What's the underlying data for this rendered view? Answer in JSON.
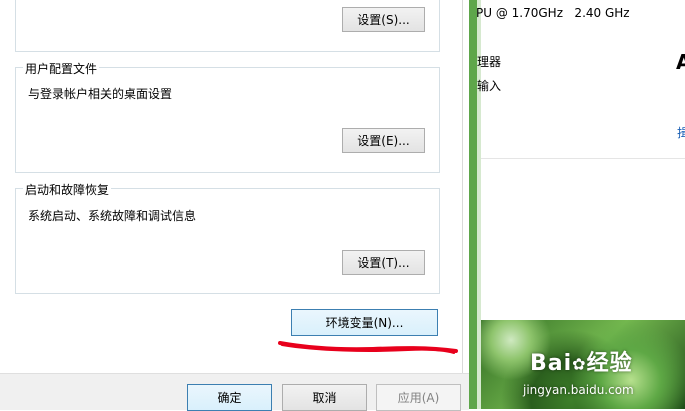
{
  "dialog": {
    "performance_group": {
      "button_label": "设置(S)..."
    },
    "user_profiles_group": {
      "title": "用户配置文件",
      "description": "与登录帐户相关的桌面设置",
      "button_label": "设置(E)..."
    },
    "startup_recovery_group": {
      "title": "启动和故障恢复",
      "description": "系统启动、系统故障和调试信息",
      "button_label": "设置(T)..."
    },
    "env_vars_button_label": "环境变量(N)...",
    "footer": {
      "ok_label": "确定",
      "cancel_label": "取消",
      "apply_label": "应用(A)"
    }
  },
  "system_panel": {
    "processor_fragment": "PU @ 1.70GHz   2.40 GHz",
    "row2_fragment": "理器",
    "row3_fragment": "输入",
    "right_edge_char": "A",
    "link_fragment": "揖"
  },
  "watermark": {
    "logo_text": "Bai",
    "logo_text2": "经验",
    "url": "jingyan.baidu.com"
  },
  "colors": {
    "green_strip": "#5ea64a",
    "annotation_red": "#e8001c",
    "link_blue": "#1a5fb4"
  }
}
